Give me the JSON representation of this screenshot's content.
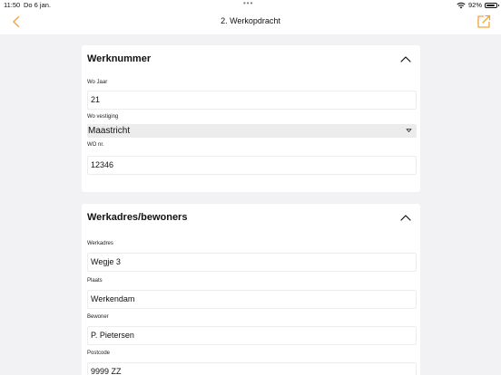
{
  "status_bar": {
    "time": "11:50",
    "date": "Do 6 jan.",
    "battery": "92%",
    "battery_level": 0.92
  },
  "nav": {
    "title": "2. Werkopdracht"
  },
  "colors": {
    "accent": "#f2a33a",
    "background": "#f2f2f4",
    "card": "#ffffff",
    "select_bg": "#ececec"
  },
  "sections": [
    {
      "title": "Werknummer",
      "fields": [
        {
          "label": "Wo Jaar",
          "value": "21"
        },
        {
          "label": "Wo vestiging",
          "value": "Maastricht"
        },
        {
          "label": "WO nr.",
          "value": "12346"
        }
      ]
    },
    {
      "title": "Werkadres/bewoners",
      "fields": [
        {
          "label": "Werkadres",
          "value": "Wegje 3"
        },
        {
          "label": "Plaats",
          "value": "Werkendam"
        },
        {
          "label": "Bewoner",
          "value": "P. Pietersen"
        },
        {
          "label": "Postcode",
          "value": "9999 ZZ"
        }
      ]
    }
  ]
}
